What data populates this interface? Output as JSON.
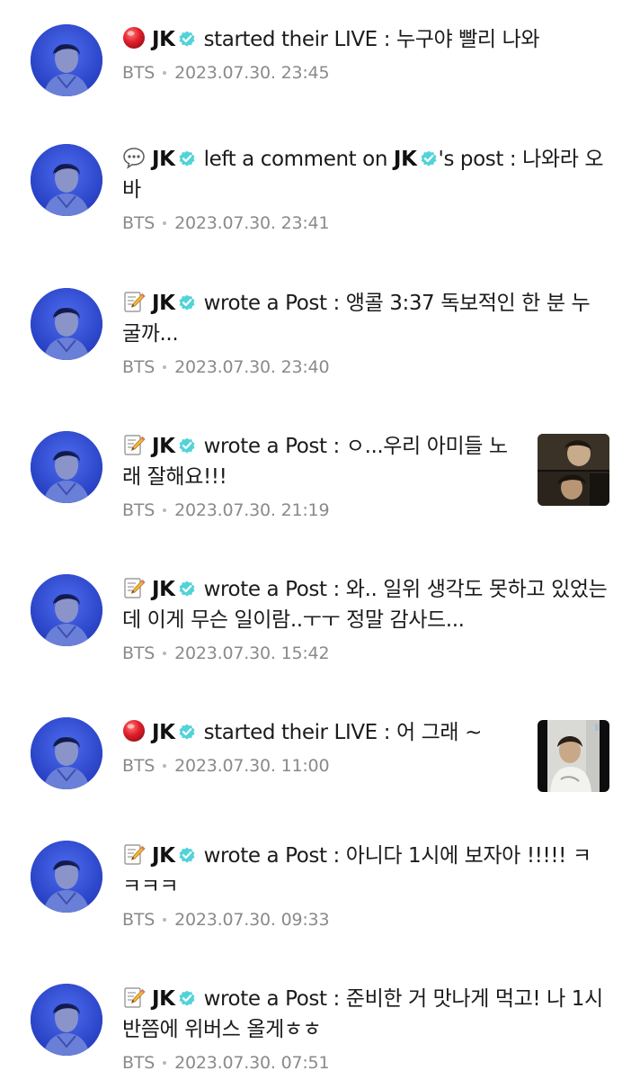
{
  "feed": {
    "items": [
      {
        "icon": "live-dot-icon",
        "author": "JK",
        "action": "started their LIVE : 누구야 빨리 나와",
        "target": null,
        "text": "",
        "community": "BTS",
        "time": "2023.07.30. 23:45",
        "thumbnail": null
      },
      {
        "icon": "speech-bubble-icon",
        "author": "JK",
        "action": "left a comment on",
        "target": "JK",
        "text": "'s post : 나와라 오바",
        "community": "BTS",
        "time": "2023.07.30. 23:41",
        "thumbnail": null
      },
      {
        "icon": "memo-icon",
        "author": "JK",
        "action": "wrote a Post : 앵콜 3:37 독보적인 한 분 누굴까...",
        "target": null,
        "text": "",
        "community": "BTS",
        "time": "2023.07.30. 23:40",
        "thumbnail": null
      },
      {
        "icon": "memo-icon",
        "author": "JK",
        "action": "wrote a Post : ㅇ...우리 아미들 노래 잘해요!!!",
        "target": null,
        "text": "",
        "community": "BTS",
        "time": "2023.07.30. 21:19",
        "thumbnail": "post-photo"
      },
      {
        "icon": "memo-icon",
        "author": "JK",
        "action": "wrote a Post : 와.. 일위 생각도 못하고 있었는데 이게 무슨 일이람..ㅜㅜ 정말 감사드...",
        "target": null,
        "text": "",
        "community": "BTS",
        "time": "2023.07.30. 15:42",
        "thumbnail": null
      },
      {
        "icon": "live-dot-icon",
        "author": "JK",
        "action": "started their LIVE : 어 그래 ~",
        "target": null,
        "text": "",
        "community": "BTS",
        "time": "2023.07.30. 11:00",
        "thumbnail": "live-photo"
      },
      {
        "icon": "memo-icon",
        "author": "JK",
        "action": "wrote a Post : 아니다 1시에 보자아 !!!!! ㅋㅋㅋㅋ",
        "target": null,
        "text": "",
        "community": "BTS",
        "time": "2023.07.30. 09:33",
        "thumbnail": null
      },
      {
        "icon": "memo-icon",
        "author": "JK",
        "action": "wrote a Post : 준비한 거 맛나게 먹고! 나 1시 반쯤에 위버스 올게ㅎㅎ",
        "target": null,
        "text": "",
        "community": "BTS",
        "time": "2023.07.30. 07:51",
        "thumbnail": null
      }
    ]
  },
  "colors": {
    "verified_badge": "#52d3d8",
    "live_dot": "#e1202a",
    "meta_text": "#8a8a8a",
    "avatar_bg": "#2f4bd4"
  }
}
